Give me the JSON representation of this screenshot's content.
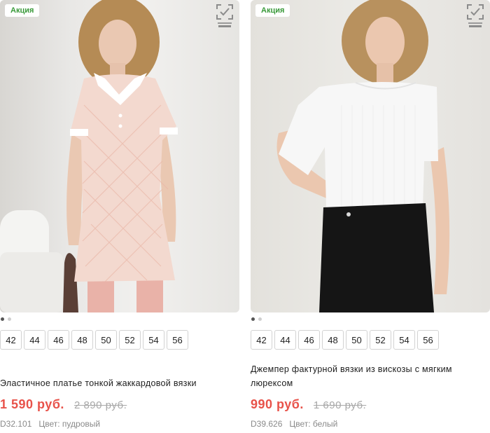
{
  "products": [
    {
      "badge": "Акция",
      "title": "Эластичное платье тонкой жаккардовой вязки",
      "price": "1 590 руб.",
      "old_price": "2 890 руб.",
      "sku": "D32.101",
      "color": "Цвет: пудровый",
      "sizes": [
        "42",
        "44",
        "46",
        "48",
        "50",
        "52",
        "54",
        "56"
      ],
      "garment_color": "#f3d9cf"
    },
    {
      "badge": "Акция",
      "title": "Джемпер фактурной вязки из вискозы с мягким люрексом",
      "price": "990 руб.",
      "old_price": "1 690 руб.",
      "sku": "D39.626",
      "color": "Цвет: белый",
      "sizes": [
        "42",
        "44",
        "46",
        "48",
        "50",
        "52",
        "54",
        "56"
      ],
      "garment_color": "#f7f7f7"
    }
  ],
  "colors": {
    "badge_text": "#3a9a3a",
    "price": "#e8524a",
    "old_price": "#a8a8a8",
    "meta": "#8a8a8a"
  },
  "icons": {
    "honest_mark": "honest-mark-icon"
  }
}
